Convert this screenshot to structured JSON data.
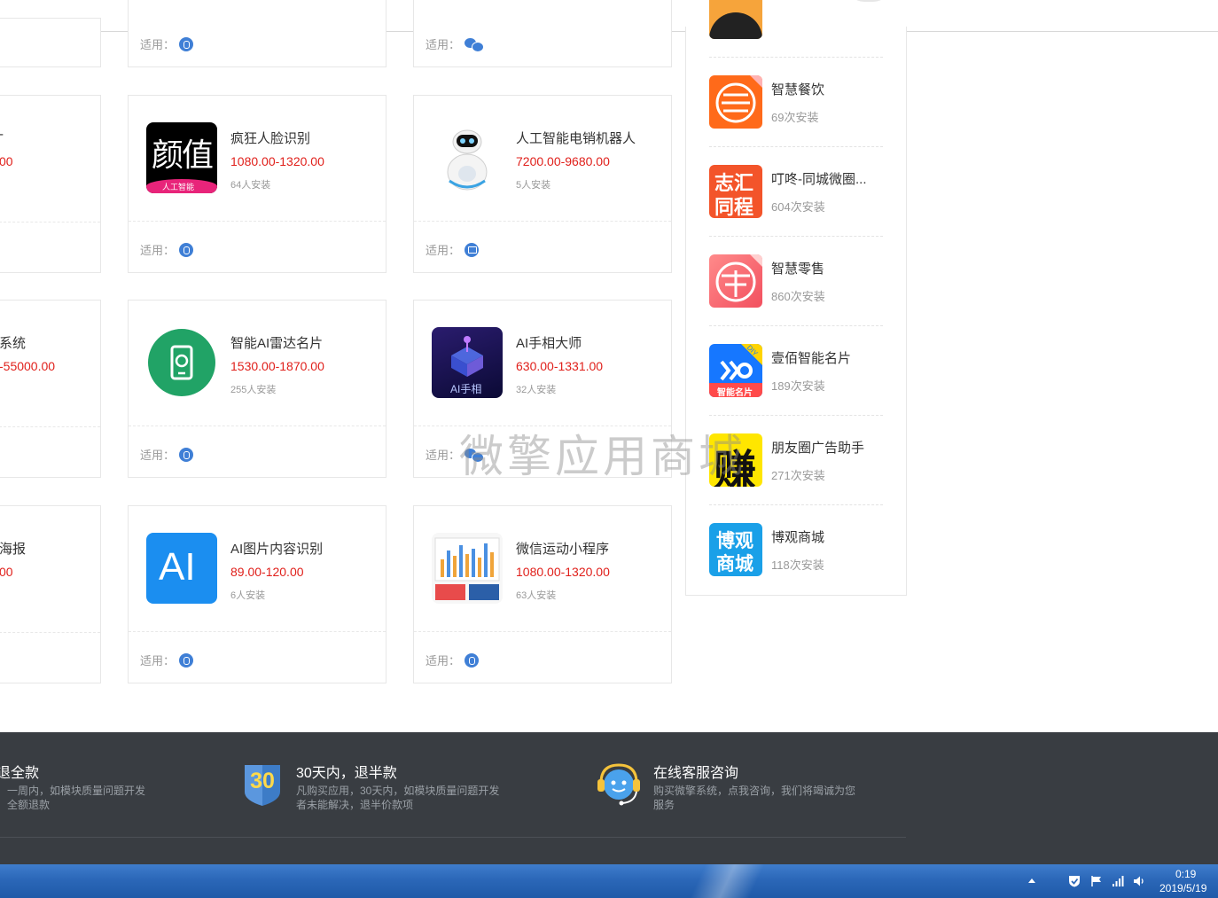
{
  "cards": [
    {
      "name": "疯狂人脸识别",
      "price": "1080.00-1320.00",
      "installs": "64人安装",
      "icon": "yanzhi-face-icon"
    },
    {
      "name": "人工智能电销机器人",
      "price": "7200.00-9680.00",
      "installs": "5人安装",
      "icon": "robot-icon"
    },
    {
      "name": "智能AI雷达名片",
      "price": "1530.00-1870.00",
      "installs": "255人安装",
      "icon": "radar-card-icon"
    },
    {
      "name": "AI手相大师",
      "price": "630.00-1331.00",
      "installs": "32人安装",
      "icon": "ai-palm-icon",
      "icon_text": "AI手相"
    },
    {
      "name": "AI图片内容识别",
      "price": "89.00-120.00",
      "installs": "6人安装",
      "icon": "ai-image-icon",
      "icon_text": "AI"
    },
    {
      "name": "微信运动小程序",
      "price": "1080.00-1320.00",
      "installs": "63人安装",
      "icon": "wechat-sport-icon"
    }
  ],
  "yanzhi": {
    "big": "颜值",
    "small": "人工智能"
  },
  "apply_label": "适用：",
  "partials": {
    "row2_price": "00",
    "row3_name": "系统",
    "row3_price": "-55000.00",
    "row4_name": "海报",
    "row4_price": "00"
  },
  "sidebar": [
    {
      "name": "智慧餐饮",
      "count": "69次安装",
      "icon": "smart-dining-icon"
    },
    {
      "name": "叮咚-同城微圈...",
      "count": "604次安装",
      "icon": "zhihui-tongcheng-icon",
      "icon_text": [
        "志汇",
        "同程"
      ]
    },
    {
      "name": "智慧零售",
      "count": "860次安装",
      "icon": "smart-retail-icon"
    },
    {
      "name": "壹佰智能名片",
      "count": "189次安装",
      "icon": "yibai-card-icon",
      "icon_text": "智能名片",
      "badge": "DIY"
    },
    {
      "name": "朋友圈广告助手",
      "count": "271次安装",
      "icon": "zhuan-icon",
      "icon_text": "赚"
    },
    {
      "name": "博观商城",
      "count": "118次安装",
      "icon": "boguan-mall-icon",
      "icon_text": [
        "博观",
        "商城"
      ]
    }
  ],
  "watermark": "微擎应用商城",
  "footer": {
    "col1_title": "退全款",
    "col1_desc1": "，一周内，如模块质量问题开发",
    "col1_desc2": "，全额退款",
    "col2_badge": "30",
    "col2_title": "30天内，退半款",
    "col2_desc1": "凡购买应用，30天内，如模块质量问题开发",
    "col2_desc2": "者未能解决，退半价款项",
    "col3_title": "在线客服咨询",
    "col3_desc1": "购买微擎系统，点我咨询，我们将竭诚为您",
    "col3_desc2": "服务"
  },
  "taskbar": {
    "time": "0:19",
    "date": "2019/5/19"
  },
  "colors": {
    "price": "#e0201b",
    "platform": "#3f7fd6",
    "footer_bg": "#393d42",
    "taskbar": "#2b67b8"
  }
}
